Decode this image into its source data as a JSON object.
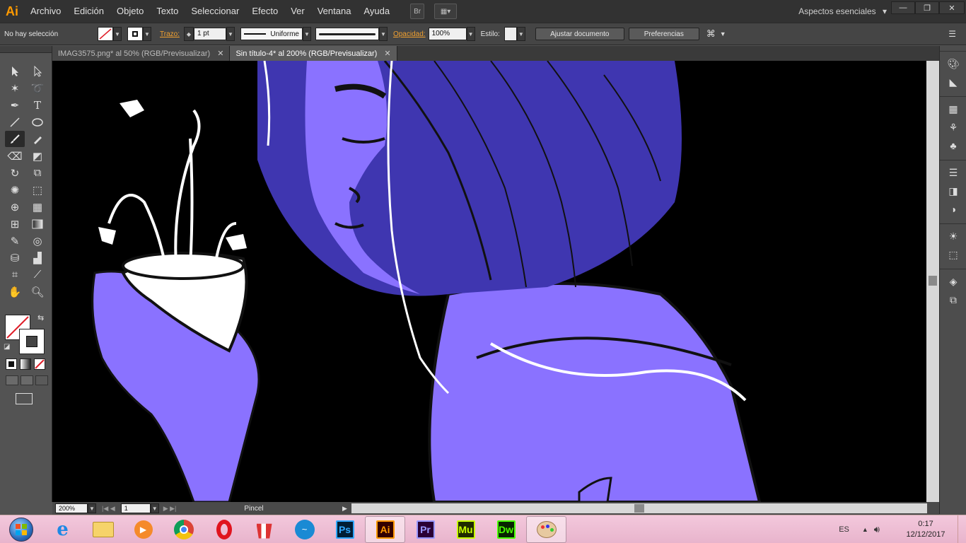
{
  "app": {
    "logo": "Ai"
  },
  "menu": [
    "Archivo",
    "Edición",
    "Objeto",
    "Texto",
    "Seleccionar",
    "Efecto",
    "Ver",
    "Ventana",
    "Ayuda"
  ],
  "menu_buttons": {
    "bridge": "Br",
    "arrange": "▦▾"
  },
  "workspace": {
    "label": "Aspectos esenciales",
    "arrow": "▾"
  },
  "window_controls": {
    "minimize": "—",
    "restore": "❐",
    "close": "✕"
  },
  "control": {
    "selection": "No hay selección",
    "stroke_label": "Trazo:",
    "stroke_weight": "1 pt",
    "profile": "Uniforme",
    "opacity_label": "Opacidad:",
    "opacity": "100%",
    "style_label": "Estilo:",
    "doc_setup": "Ajustar documento",
    "prefs": "Preferencias"
  },
  "tabs": [
    {
      "label": "IMAG3575.png* al 50% (RGB/Previsualizar)",
      "close": "✕",
      "active": false
    },
    {
      "label": "Sin título-4* al 200% (RGB/Previsualizar)",
      "close": "✕",
      "active": true
    }
  ],
  "status": {
    "zoom": "200%",
    "page": "1",
    "tool": "Pincel"
  },
  "taskbar": {
    "apps": [
      "ie-icon",
      "explorer-icon",
      "media-player-icon",
      "chrome-icon",
      "opera-icon",
      "popcorn-icon",
      "skype-icon",
      "Ps",
      "Ai",
      "Pr",
      "Mu",
      "Dw",
      "paint-icon"
    ],
    "lang": "ES",
    "time": "0:17",
    "date": "12/12/2017"
  },
  "colors": {
    "purple_skin": "#8a72ff",
    "purple_hair": "#3f36b0",
    "ps": "#31a8ff",
    "ai": "#ff9a00",
    "pr": "#9999ff",
    "mu": "#c8ff00",
    "dw": "#4aff00"
  }
}
